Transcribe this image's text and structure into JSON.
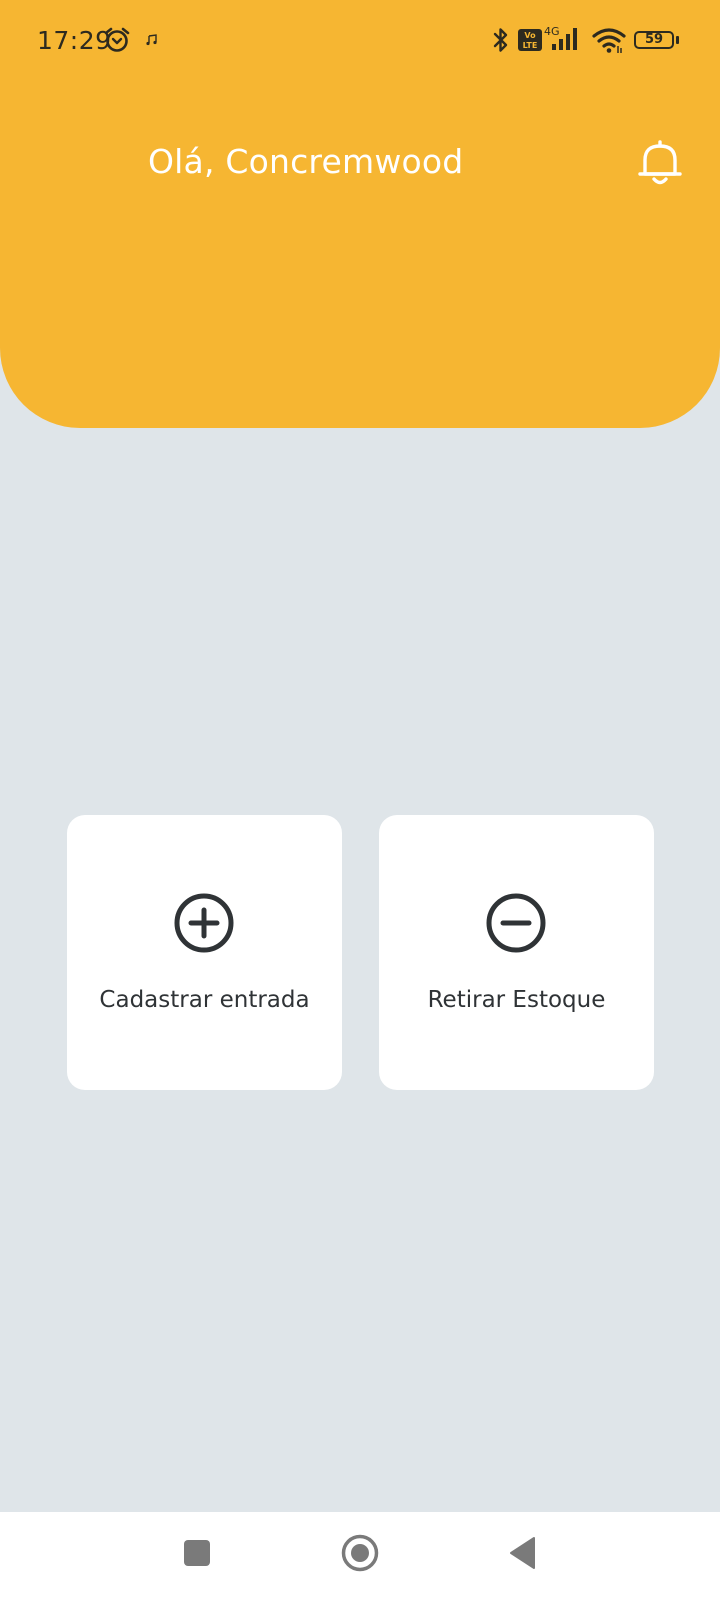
{
  "status_bar": {
    "time": "17:29",
    "battery_level": "59",
    "network_label": "4G",
    "volte_label": "Vo LTE",
    "icons": [
      "alarm-icon",
      "music-note-icon",
      "bluetooth-icon",
      "volte-icon",
      "signal-icon",
      "wifi-icon",
      "battery-icon"
    ]
  },
  "header": {
    "greeting": "Olá, Concremwood",
    "bell_icon": "bell-icon",
    "background_color": "#f6b632"
  },
  "actions": [
    {
      "label": "Cadastrar entrada",
      "icon": "plus-circle-icon"
    },
    {
      "label": "Retirar Estoque",
      "icon": "minus-circle-icon"
    }
  ],
  "navigation_bar": {
    "buttons": [
      "recents-square-icon",
      "home-circle-icon",
      "back-triangle-icon"
    ]
  },
  "colors": {
    "accent": "#f6b632",
    "page_background": "#dfe5e9",
    "card_background": "#ffffff",
    "icon_dark": "#2f3336"
  }
}
